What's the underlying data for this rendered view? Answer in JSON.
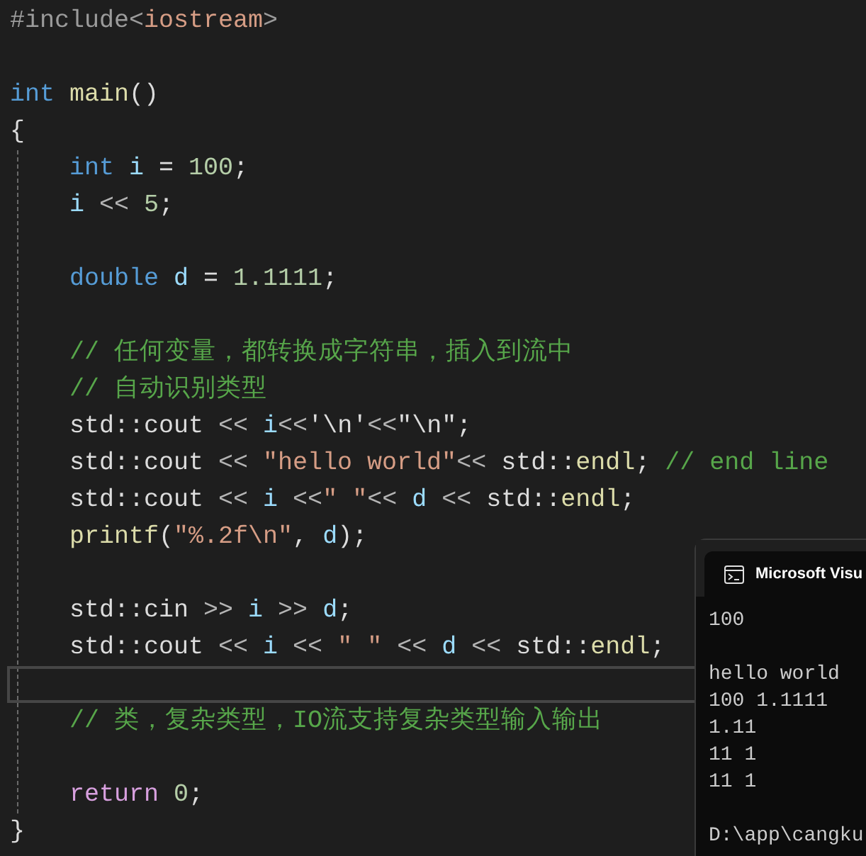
{
  "editor": {
    "lines": [
      {
        "kind": "code",
        "current": false,
        "tokens": [
          {
            "kind": "preproc",
            "text": "#include<"
          },
          {
            "kind": "string",
            "text": "iostream"
          },
          {
            "kind": "preproc",
            "text": ">"
          }
        ]
      },
      {
        "kind": "blank",
        "current": false
      },
      {
        "kind": "code",
        "current": false,
        "tokens": [
          {
            "kind": "keyword",
            "text": "int"
          },
          {
            "kind": "function",
            "text": " main"
          },
          {
            "kind": "plain",
            "text": "()"
          }
        ]
      },
      {
        "kind": "code",
        "current": false,
        "tokens": [
          {
            "kind": "plain",
            "text": "{"
          }
        ],
        "children": [
          {
            "kind": "code",
            "current": false,
            "tokens": [
              {
                "kind": "keyword",
                "text": "int"
              },
              {
                "kind": "variable",
                "text": " i"
              },
              {
                "kind": "plain",
                "text": " = "
              },
              {
                "kind": "number",
                "text": "100"
              },
              {
                "kind": "plain",
                "text": ";"
              }
            ]
          },
          {
            "kind": "code",
            "current": false,
            "tokens": [
              {
                "kind": "variable",
                "text": "i"
              },
              {
                "kind": "operator",
                "text": " << "
              },
              {
                "kind": "number",
                "text": "5"
              },
              {
                "kind": "plain",
                "text": ";"
              }
            ]
          },
          {
            "kind": "blank",
            "current": false
          },
          {
            "kind": "code",
            "current": false,
            "tokens": [
              {
                "kind": "keyword",
                "text": "double"
              },
              {
                "kind": "variable",
                "text": " d"
              },
              {
                "kind": "plain",
                "text": " = "
              },
              {
                "kind": "number",
                "text": "1.1111"
              },
              {
                "kind": "plain",
                "text": ";"
              }
            ]
          },
          {
            "kind": "blank",
            "current": false
          },
          {
            "kind": "code",
            "current": false,
            "tokens": [
              {
                "kind": "comment",
                "text": "// 任何变量，都转换成字符串，插入到流中"
              }
            ]
          },
          {
            "kind": "code",
            "current": false,
            "tokens": [
              {
                "kind": "comment",
                "text": "// 自动识别类型"
              }
            ]
          },
          {
            "kind": "code",
            "current": false,
            "tokens": [
              {
                "kind": "plain",
                "text": "std::cout"
              },
              {
                "kind": "operator",
                "text": " << "
              },
              {
                "kind": "variable",
                "text": "i"
              },
              {
                "kind": "operator",
                "text": "<<"
              },
              {
                "kind": "plain",
                "text": "'\\n'"
              },
              {
                "kind": "operator",
                "text": "<<"
              },
              {
                "kind": "plain",
                "text": "\"\\n\";"
              }
            ]
          },
          {
            "kind": "code",
            "current": false,
            "tokens": [
              {
                "kind": "plain",
                "text": "std::cout"
              },
              {
                "kind": "operator",
                "text": " << "
              },
              {
                "kind": "string",
                "text": "\"hello world\""
              },
              {
                "kind": "operator",
                "text": "<< "
              },
              {
                "kind": "plain",
                "text": "std::"
              },
              {
                "kind": "function",
                "text": "endl"
              },
              {
                "kind": "plain",
                "text": "; "
              },
              {
                "kind": "comment",
                "text": "// end line"
              }
            ]
          },
          {
            "kind": "code",
            "current": false,
            "tokens": [
              {
                "kind": "plain",
                "text": "std::cout"
              },
              {
                "kind": "operator",
                "text": " << "
              },
              {
                "kind": "variable",
                "text": "i"
              },
              {
                "kind": "operator",
                "text": " <<"
              },
              {
                "kind": "string",
                "text": "\" \""
              },
              {
                "kind": "operator",
                "text": "<< "
              },
              {
                "kind": "variable",
                "text": "d"
              },
              {
                "kind": "operator",
                "text": " << "
              },
              {
                "kind": "plain",
                "text": "std::"
              },
              {
                "kind": "function",
                "text": "endl"
              },
              {
                "kind": "plain",
                "text": ";"
              }
            ]
          },
          {
            "kind": "code",
            "current": false,
            "tokens": [
              {
                "kind": "function",
                "text": "printf"
              },
              {
                "kind": "plain",
                "text": "("
              },
              {
                "kind": "string",
                "text": "\"%.2f\\n\""
              },
              {
                "kind": "plain",
                "text": ", "
              },
              {
                "kind": "variable",
                "text": "d"
              },
              {
                "kind": "plain",
                "text": ");"
              }
            ]
          },
          {
            "kind": "blank",
            "current": false
          },
          {
            "kind": "code",
            "current": false,
            "tokens": [
              {
                "kind": "plain",
                "text": "std::cin"
              },
              {
                "kind": "operator",
                "text": " >> "
              },
              {
                "kind": "variable",
                "text": "i"
              },
              {
                "kind": "operator",
                "text": " >> "
              },
              {
                "kind": "variable",
                "text": "d"
              },
              {
                "kind": "plain",
                "text": ";"
              }
            ]
          },
          {
            "kind": "code",
            "current": false,
            "tokens": [
              {
                "kind": "plain",
                "text": "std::cout"
              },
              {
                "kind": "operator",
                "text": " << "
              },
              {
                "kind": "variable",
                "text": "i"
              },
              {
                "kind": "operator",
                "text": " << "
              },
              {
                "kind": "string",
                "text": "\" \""
              },
              {
                "kind": "operator",
                "text": " << "
              },
              {
                "kind": "variable",
                "text": "d"
              },
              {
                "kind": "operator",
                "text": " << "
              },
              {
                "kind": "plain",
                "text": "std::"
              },
              {
                "kind": "function",
                "text": "endl"
              },
              {
                "kind": "plain",
                "text": ";"
              }
            ]
          },
          {
            "kind": "blank",
            "current": true
          },
          {
            "kind": "code",
            "current": false,
            "tokens": [
              {
                "kind": "comment",
                "text": "// 类，复杂类型，IO流支持复杂类型输入输出"
              }
            ]
          },
          {
            "kind": "blank",
            "current": false
          },
          {
            "kind": "code",
            "current": false,
            "tokens": [
              {
                "kind": "control",
                "text": "return"
              },
              {
                "kind": "number",
                "text": " 0"
              },
              {
                "kind": "plain",
                "text": ";"
              }
            ]
          }
        ]
      },
      {
        "kind": "code",
        "current": false,
        "tokens": [
          {
            "kind": "plain",
            "text": "}"
          }
        ]
      }
    ]
  },
  "console": {
    "title": "Microsoft Visu",
    "output": [
      {
        "kind": "text",
        "text": "100"
      },
      {
        "kind": "blank"
      },
      {
        "kind": "text",
        "text": "hello world"
      },
      {
        "kind": "text",
        "text": "100 1.1111"
      },
      {
        "kind": "text",
        "text": "1.11"
      },
      {
        "kind": "text",
        "text": "11 1"
      },
      {
        "kind": "text",
        "text": "11 1"
      },
      {
        "kind": "blank"
      },
      {
        "kind": "text",
        "text": "D:\\app\\cangku"
      }
    ]
  }
}
